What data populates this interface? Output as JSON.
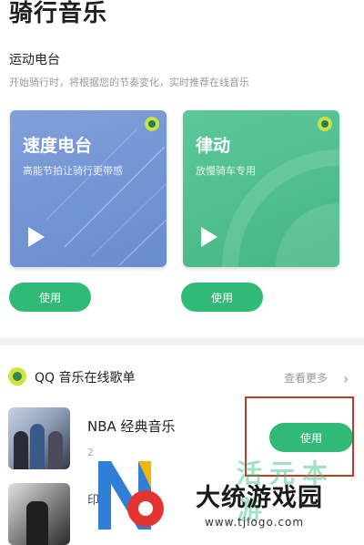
{
  "page": {
    "title": "骑行音乐"
  },
  "radio_section": {
    "title": "运动电台",
    "subtitle": "开始骑行时，将根据您的节奏变化，实时推荐在线音乐",
    "cards": [
      {
        "title": "速度电台",
        "subtitle": "高能节拍让骑行更带感",
        "button_label": "使用",
        "color": "#7495d4"
      },
      {
        "title": "律动",
        "subtitle": "放慢骑车专用",
        "button_label": "使用",
        "color": "#52c191"
      }
    ]
  },
  "online_section": {
    "title": "QQ 音乐在线歌单",
    "more_label": "查看更多",
    "chevron_icon": "chevron-right-icon",
    "items": [
      {
        "title": "NBA 经典音乐",
        "subtitle": "2",
        "button_label": "使用"
      },
      {
        "title": "印",
        "subtitle": ""
      }
    ]
  },
  "watermark": {
    "brand": "大统游戏园",
    "url": "www.tjlogo.com",
    "faint_text": "活元本游"
  },
  "colors": {
    "accent": "#2fba78",
    "highlight": "#c0392b"
  }
}
